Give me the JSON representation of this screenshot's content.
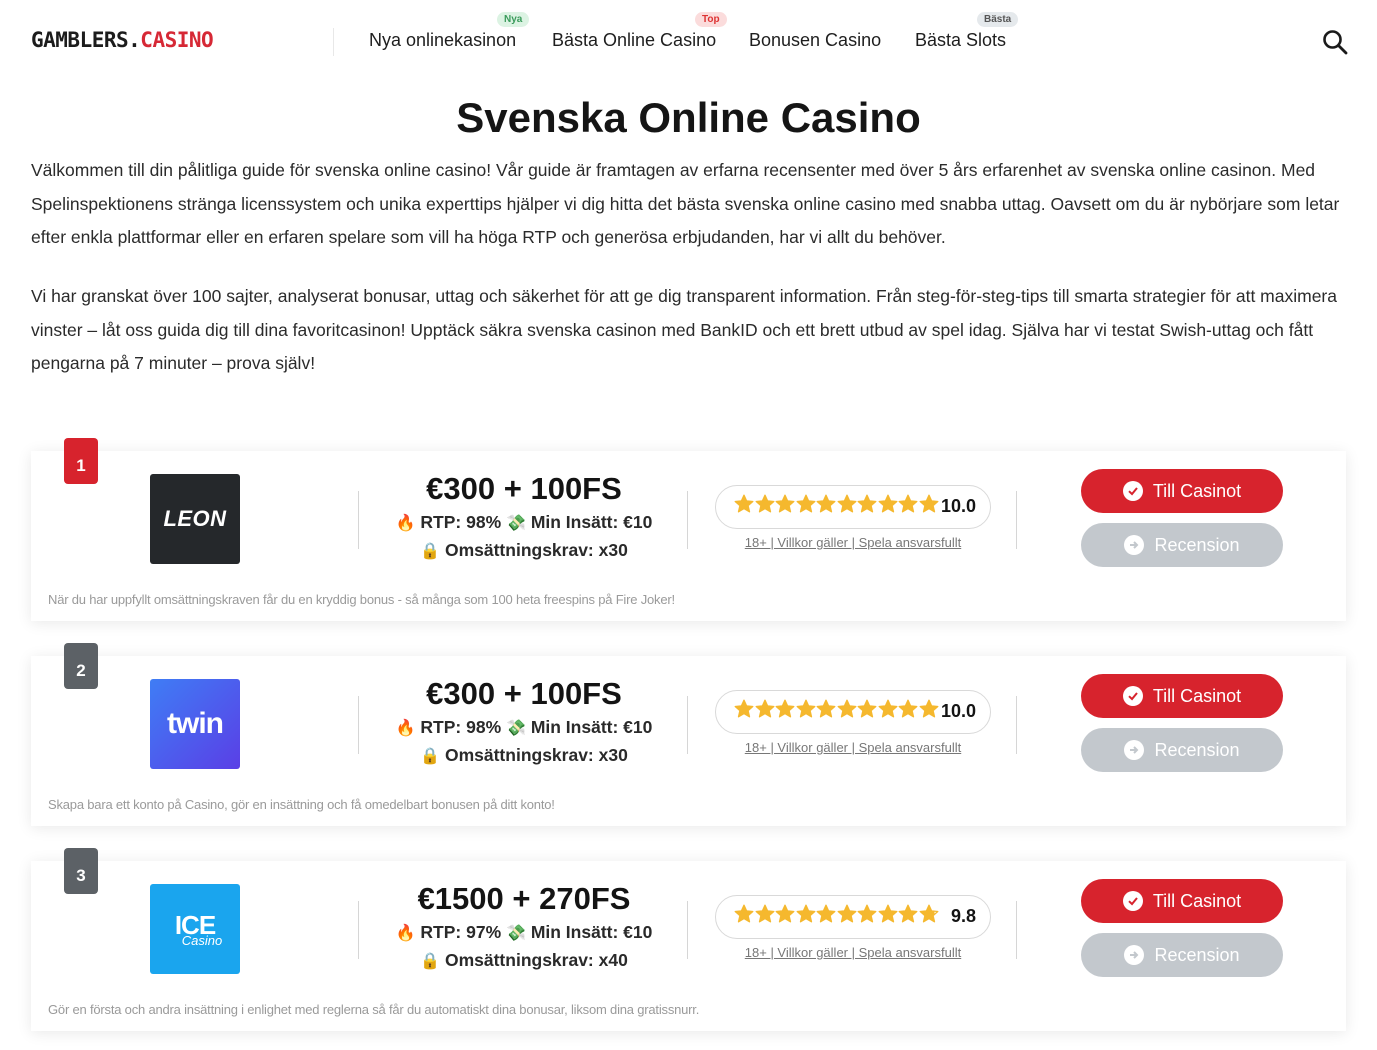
{
  "header": {
    "logo_main": "GAMBLERS.",
    "logo_accent": "CASINO",
    "nav": [
      {
        "label": "Nya onlinekasinon",
        "badge": "Nya"
      },
      {
        "label": "Bästa Online Casino",
        "badge": "Top"
      },
      {
        "label": "Bonusen Casino",
        "badge": ""
      },
      {
        "label": "Bästa Slots",
        "badge": "Bästa"
      }
    ],
    "search_icon": "search-icon"
  },
  "page": {
    "title": "Svenska Online Casino",
    "intro_1": "Välkommen till din pålitliga guide för svenska online casino! Vår guide är framtagen av erfarna recensenter med över 5 års erfarenhet av svenska online casinon. Med Spelinspektionens stränga licenssystem och unika experttips hjälper vi dig hitta det bästa svenska online casino med snabba uttag. Oavsett om du är nybörjare som letar efter enkla plattformar eller en erfaren spelare som vill ha höga RTP och generösa erbjudanden, har vi allt du behöver.",
    "intro_2": "Vi har granskat över 100 sajter, analyserat bonusar, uttag och säkerhet för att ge dig transparent information. Från steg-för-steg-tips till smarta strategier för att maximera vinster – låt oss guida dig till dina favoritcasinon! Upptäck säkra svenska casinon med BankID och ett brett utbud av spel idag. Själva har vi testat Swish-uttag och fått pengarna på 7 minuter – prova själv!"
  },
  "colors": {
    "accent": "#d7232d",
    "rank_other": "#5c6166",
    "secondary_button": "#c3c8cd",
    "star": "#f5b82e"
  },
  "casinos": [
    {
      "rank": "1",
      "logo_text": "LEON",
      "logo_bg": "#25282b",
      "bonus": "€300 + 100FS",
      "rtp": "RTP: 98%",
      "min_deposit": "Min Insätt: €10",
      "wagering": "Omsättningskrav: x30",
      "rating": 10.0,
      "score": "10.0",
      "terms": "18+ | Villkor gäller | Spela ansvarsfullt",
      "cta_primary": "Till Casinot",
      "cta_secondary": "Recension",
      "description": "När du har uppfyllt omsättningskraven får du en kryddig bonus - så många som 100 heta freespins på Fire Joker!"
    },
    {
      "rank": "2",
      "logo_text": "twin",
      "logo_bg": "#3d63f0",
      "bonus": "€300 + 100FS",
      "rtp": "RTP: 98%",
      "min_deposit": "Min Insätt: €10",
      "wagering": "Omsättningskrav: x30",
      "rating": 10.0,
      "score": "10.0",
      "terms": "18+ | Villkor gäller | Spela ansvarsfullt",
      "cta_primary": "Till Casinot",
      "cta_secondary": "Recension",
      "description": "Skapa bara ett konto på Casino, gör en insättning och få omedelbart bonusen på ditt konto!"
    },
    {
      "rank": "3",
      "logo_text": "ICE",
      "logo_subtext": "Casino",
      "logo_bg": "#1aa5ee",
      "bonus": "€1500 + 270FS",
      "rtp": "RTP: 97%",
      "min_deposit": "Min Insätt: €10",
      "wagering": "Omsättningskrav: x40",
      "rating": 9.8,
      "score": "9.8",
      "terms": "18+ | Villkor gäller | Spela ansvarsfullt",
      "cta_primary": "Till Casinot",
      "cta_secondary": "Recension",
      "description": "Gör en första och andra insättning i enlighet med reglerna så får du automatiskt dina bonusar, liksom dina gratissnurr."
    }
  ]
}
